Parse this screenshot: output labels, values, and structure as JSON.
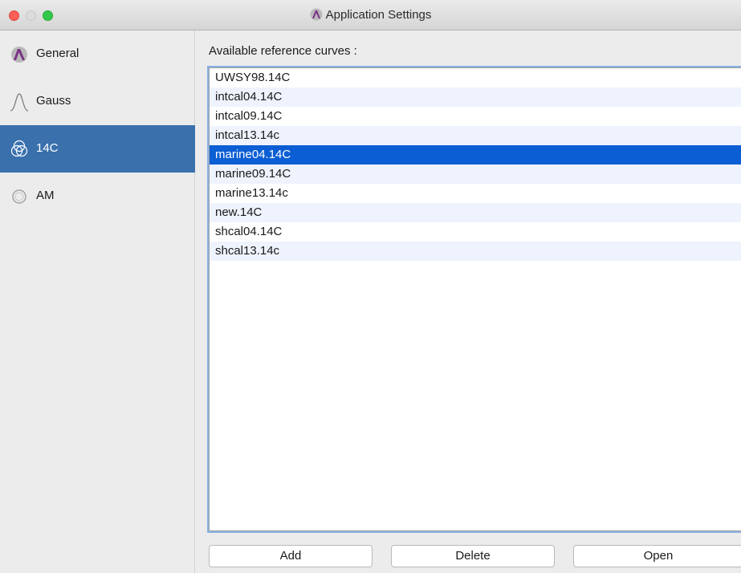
{
  "window": {
    "title": "Application Settings",
    "app_icon": "chronomodel-logo-icon"
  },
  "sidebar": {
    "items": [
      {
        "label": "General",
        "icon": "chronomodel-logo-icon"
      },
      {
        "label": "Gauss",
        "icon": "gauss-curve-icon"
      },
      {
        "label": "14C",
        "icon": "circles-icon",
        "selected": true
      },
      {
        "label": "AM",
        "icon": "magnet-ring-icon"
      }
    ]
  },
  "main": {
    "caption": "Available reference curves :",
    "curves": [
      "UWSY98.14C",
      "intcal04.14C",
      "intcal09.14C",
      "intcal13.14c",
      "marine04.14C",
      "marine09.14C",
      "marine13.14c",
      "new.14C",
      "shcal04.14C",
      "shcal13.14c"
    ],
    "selected": "marine04.14C",
    "buttons": {
      "add": "Add",
      "delete": "Delete",
      "open": "Open"
    }
  },
  "colors": {
    "selection": "#0b5ed4",
    "sidebar_selection": "#3a71ad",
    "alt_row": "#eef3fd"
  }
}
